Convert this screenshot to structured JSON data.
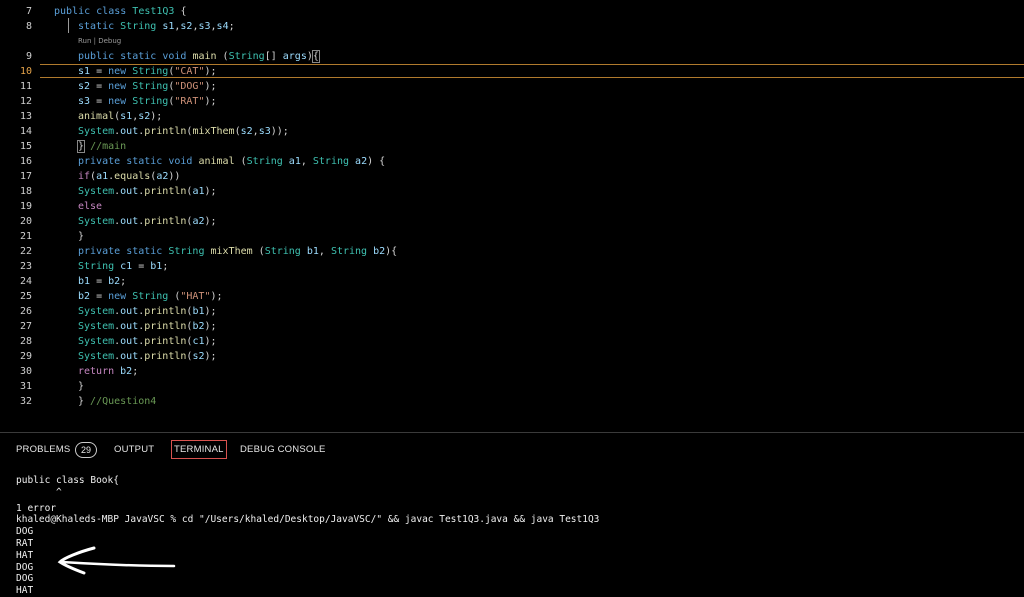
{
  "editor": {
    "lines": [
      {
        "num": "7",
        "html": "<span class=\"kw\">public</span> <span class=\"kw\">class</span> <span class=\"ty\">Test1Q3</span> {"
      },
      {
        "num": "8",
        "html": "<span class=\"kw\">static</span> <span class=\"ty\">String</span> <span class=\"var\">s1</span>,<span class=\"var\">s2</span>,<span class=\"var\">s3</span>,<span class=\"var\">s4</span>;",
        "indent": true
      },
      {
        "num": "9",
        "html": "<span class=\"kw\">public</span> <span class=\"kw\">static</span> <span class=\"kw\">void</span> <span class=\"fn\">main</span> (<span class=\"ty\">String</span>[] <span class=\"var\">args</span>)<span class=\"bracket\">{</span>",
        "indent": true
      },
      {
        "num": "10",
        "html": "<span class=\"var\">s1</span> = <span class=\"kw\">new</span> <span class=\"ty\">String</span>(<span class=\"str\">\"CAT\"</span>);",
        "indent": true,
        "active": true
      },
      {
        "num": "11",
        "html": "<span class=\"var\">s2</span> = <span class=\"kw\">new</span> <span class=\"ty\">String</span>(<span class=\"str\">\"DOG\"</span>);",
        "indent": true
      },
      {
        "num": "12",
        "html": "<span class=\"var\">s3</span> = <span class=\"kw\">new</span> <span class=\"ty\">String</span>(<span class=\"str\">\"RAT\"</span>);",
        "indent": true
      },
      {
        "num": "13",
        "html": "<span class=\"fn\">animal</span>(<span class=\"var\">s1</span>,<span class=\"var\">s2</span>);",
        "indent": true
      },
      {
        "num": "14",
        "html": "<span class=\"ty\">System</span>.<span class=\"var\">out</span>.<span class=\"fn\">println</span>(<span class=\"fn\">mixThem</span>(<span class=\"var\">s2</span>,<span class=\"var\">s3</span>));",
        "indent": true
      },
      {
        "num": "15",
        "html": "<span class=\"bracket\">}</span> <span class=\"cm\">//main</span>",
        "indent": true
      },
      {
        "num": "16",
        "html": "<span class=\"kw\">private</span> <span class=\"kw\">static</span> <span class=\"kw\">void</span> <span class=\"fn\">animal</span> (<span class=\"ty\">String</span> <span class=\"var\">a1</span>, <span class=\"ty\">String</span> <span class=\"var\">a2</span>) {",
        "indent": true
      },
      {
        "num": "17",
        "html": "<span class=\"ctl\">if</span>(<span class=\"var\">a1</span>.<span class=\"fn\">equals</span>(<span class=\"var\">a2</span>))",
        "indent": true
      },
      {
        "num": "18",
        "html": "<span class=\"ty\">System</span>.<span class=\"var\">out</span>.<span class=\"fn\">println</span>(<span class=\"var\">a1</span>);",
        "indent": true
      },
      {
        "num": "19",
        "html": "<span class=\"ctl\">else</span>",
        "indent": true
      },
      {
        "num": "20",
        "html": "<span class=\"ty\">System</span>.<span class=\"var\">out</span>.<span class=\"fn\">println</span>(<span class=\"var\">a2</span>);",
        "indent": true
      },
      {
        "num": "21",
        "html": "}",
        "indent": true
      },
      {
        "num": "22",
        "html": "<span class=\"kw\">private</span> <span class=\"kw\">static</span> <span class=\"ty\">String</span> <span class=\"fn\">mixThem</span> (<span class=\"ty\">String</span> <span class=\"var\">b1</span>, <span class=\"ty\">String</span> <span class=\"var\">b2</span>){",
        "indent": true
      },
      {
        "num": "23",
        "html": "<span class=\"ty\">String</span> <span class=\"var\">c1</span> = <span class=\"var\">b1</span>;",
        "indent": true
      },
      {
        "num": "24",
        "html": "<span class=\"var\">b1</span> = <span class=\"var\">b2</span>;",
        "indent": true
      },
      {
        "num": "25",
        "html": "<span class=\"var\">b2</span> = <span class=\"kw\">new</span> <span class=\"ty\">String</span> (<span class=\"str\">\"HAT\"</span>);",
        "indent": true
      },
      {
        "num": "26",
        "html": "<span class=\"ty\">System</span>.<span class=\"var\">out</span>.<span class=\"fn\">println</span>(<span class=\"var\">b1</span>);",
        "indent": true
      },
      {
        "num": "27",
        "html": "<span class=\"ty\">System</span>.<span class=\"var\">out</span>.<span class=\"fn\">println</span>(<span class=\"var\">b2</span>);",
        "indent": true
      },
      {
        "num": "28",
        "html": "<span class=\"ty\">System</span>.<span class=\"var\">out</span>.<span class=\"fn\">println</span>(<span class=\"var\">c1</span>);",
        "indent": true
      },
      {
        "num": "29",
        "html": "<span class=\"ty\">System</span>.<span class=\"var\">out</span>.<span class=\"fn\">println</span>(<span class=\"var\">s2</span>);",
        "indent": true
      },
      {
        "num": "30",
        "html": "<span class=\"ctl\">return</span> <span class=\"var\">b2</span>;",
        "indent": true
      },
      {
        "num": "31",
        "html": "}",
        "indent": true
      },
      {
        "num": "32",
        "html": "} <span class=\"cm\">//Question4</span>",
        "indent": true
      }
    ],
    "codelens": "Run | Debug"
  },
  "panel": {
    "tabs": {
      "problems": "PROBLEMS",
      "problems_count": "29",
      "output": "OUTPUT",
      "terminal": "TERMINAL",
      "debug_console": "DEBUG CONSOLE"
    },
    "terminal_lines": [
      "public class Book{",
      "       ^",
      "1 error",
      "khaled@Khaleds-MBP JavaVSC % cd \"/Users/khaled/Desktop/JavaVSC/\" && javac Test1Q3.java && java Test1Q3",
      "DOG",
      "RAT",
      "HAT",
      "DOG",
      "DOG",
      "HAT"
    ]
  }
}
